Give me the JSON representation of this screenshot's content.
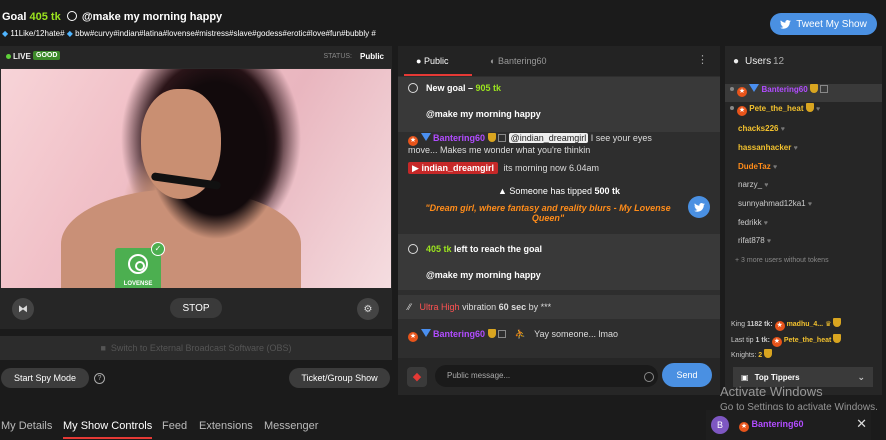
{
  "header": {
    "goal_label": "Goal",
    "goal_amount": "405 tk",
    "goal_text": "@make my morning happy",
    "tags_likes": "11Like/12hate#",
    "tags": "bbw#curvy#indian#latina#lovense#mistress#slave#godess#erotic#love#fun#bubbly #",
    "tweet_button": "Tweet My Show"
  },
  "video": {
    "live_label": "LIVE",
    "quality_badge": "GOOD",
    "status_label": "STATUS:",
    "status_value": "Public",
    "lovense_label": "LOVENSE",
    "stop_button": "STOP"
  },
  "controls": {
    "obs_text": "Switch to External Broadcast Software (OBS)",
    "start_spy": "Start Spy Mode",
    "help": "?",
    "ticket_show": "Ticket/Group Show"
  },
  "bottom_tabs": [
    "My Details",
    "My Show Controls",
    "Feed",
    "Extensions",
    "Messenger"
  ],
  "chat": {
    "tab_public": "Public",
    "tab_user": "Bantering60",
    "kebab": "⋮",
    "new_goal_label": "New goal –",
    "new_goal_amount": "905 tk",
    "goal_message": "@make my morning happy",
    "msg1_user": "Bantering60",
    "msg1_mention": "@indian_dreamgirl",
    "msg1_text_a": "I see your eyes",
    "msg1_text_b": "move... Makes me wonder what you're thinkin",
    "msg2_user": "indian_dreamgirl",
    "msg2_text": "its morning now 6.04am",
    "tip_prefix": "Someone has tipped",
    "tip_amount": "500 tk",
    "tip_quote": "\"Dream girl, where fantasy and reality blurs - My Lovense Queen\"",
    "left_amount": "405 tk",
    "left_text": "left to reach the goal",
    "goal_message2": "@make my morning happy",
    "vib_level": "Ultra High",
    "vib_text": "vibration",
    "vib_duration": "60 sec",
    "vib_by": "by ***",
    "msg3_user": "Bantering60",
    "msg3_text": "Yay someone... lmao",
    "input_placeholder": "Public message...",
    "send_button": "Send"
  },
  "users": {
    "title": "Users",
    "count": "12",
    "list": [
      "Bantering60",
      "Pete_the_heat",
      "chacks226",
      "hassanhacker",
      "DudeTaz",
      "narzy_",
      "sunnyahmad12ka1",
      "fedrikk",
      "rifat878"
    ],
    "more": "+ 3 more users without tokens",
    "king_label": "King",
    "king_amount": "1182 tk:",
    "king_user": "madhu_4...",
    "last_tip_label": "Last tip",
    "last_tip_amount": "1 tk:",
    "last_tip_user": "Pete_the_heat",
    "knights_label": "Knights:",
    "knights_count": "2",
    "top_tippers": "Top Tippers"
  },
  "overlay": {
    "activate_title": "Activate Windows",
    "activate_sub": "Go to Settings to activate Windows.",
    "avatar_letter": "B",
    "bar_user": "Bantering60",
    "close": "✕"
  },
  "colors": {
    "accent_blue": "#4a90e2",
    "goal_green": "#9be31f",
    "tab_red": "#e53935",
    "user_purple": "#b14cff",
    "user_orange": "#ff8c1a",
    "user_yellow": "#f2c12e"
  }
}
